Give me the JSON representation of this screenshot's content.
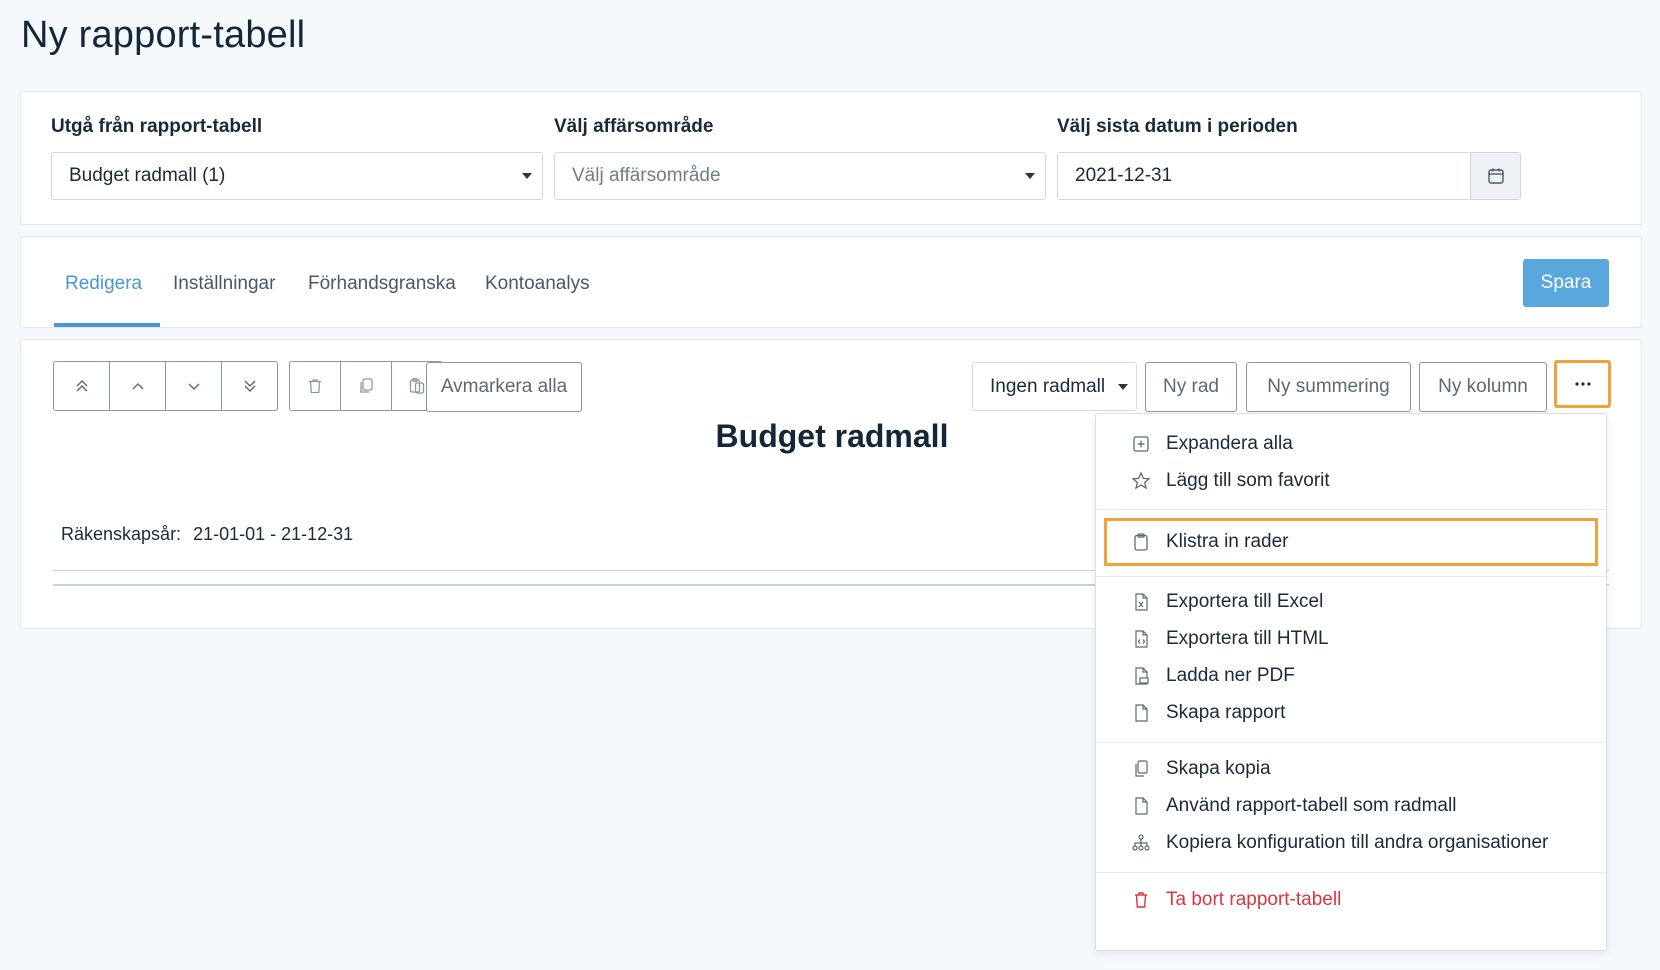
{
  "page": {
    "title": "Ny rapport-tabell"
  },
  "filters": {
    "base_table": {
      "label": "Utgå från rapport-tabell",
      "value": "Budget radmall (1)"
    },
    "business_area": {
      "label": "Välj affärsområde",
      "placeholder": "Välj affärsområde"
    },
    "period_end": {
      "label": "Välj sista datum i perioden",
      "value": "2021-12-31"
    }
  },
  "tabs": [
    {
      "label": "Redigera",
      "active": true
    },
    {
      "label": "Inställningar",
      "active": false
    },
    {
      "label": "Förhandsgranska",
      "active": false
    },
    {
      "label": "Kontoanalys",
      "active": false
    }
  ],
  "save_label": "Spara",
  "toolbar": {
    "move_buttons": [
      "move-top-icon",
      "move-up-icon",
      "move-down-icon",
      "move-bottom-icon"
    ],
    "edit_buttons": [
      "trash-icon",
      "copy-icon",
      "paste-icon"
    ],
    "deselect_all": "Avmarkera alla",
    "row_template": "Ingen radmall",
    "new_row": "Ny rad",
    "new_sum": "Ny summering",
    "new_column": "Ny kolumn",
    "more": "···"
  },
  "report": {
    "title": "Budget radmall",
    "fiscal_label": "Räkenskapsår:",
    "fiscal_range": "21-01-01 - 21-12-31"
  },
  "menu": {
    "expand_all": "Expandera alla",
    "add_favorite": "Lägg till som favorit",
    "paste_rows": "Klistra in rader",
    "export_excel": "Exportera till Excel",
    "export_html": "Exportera till HTML",
    "download_pdf": "Ladda ner PDF",
    "create_report": "Skapa rapport",
    "create_copy": "Skapa kopia",
    "use_as_template": "Använd rapport-tabell som radmall",
    "copy_config": "Kopiera konfiguration till andra organisationer",
    "delete_table": "Ta bort rapport-tabell"
  },
  "colors": {
    "accent": "#4a97d4",
    "highlight": "#f1a23a",
    "danger": "#d9363e"
  }
}
